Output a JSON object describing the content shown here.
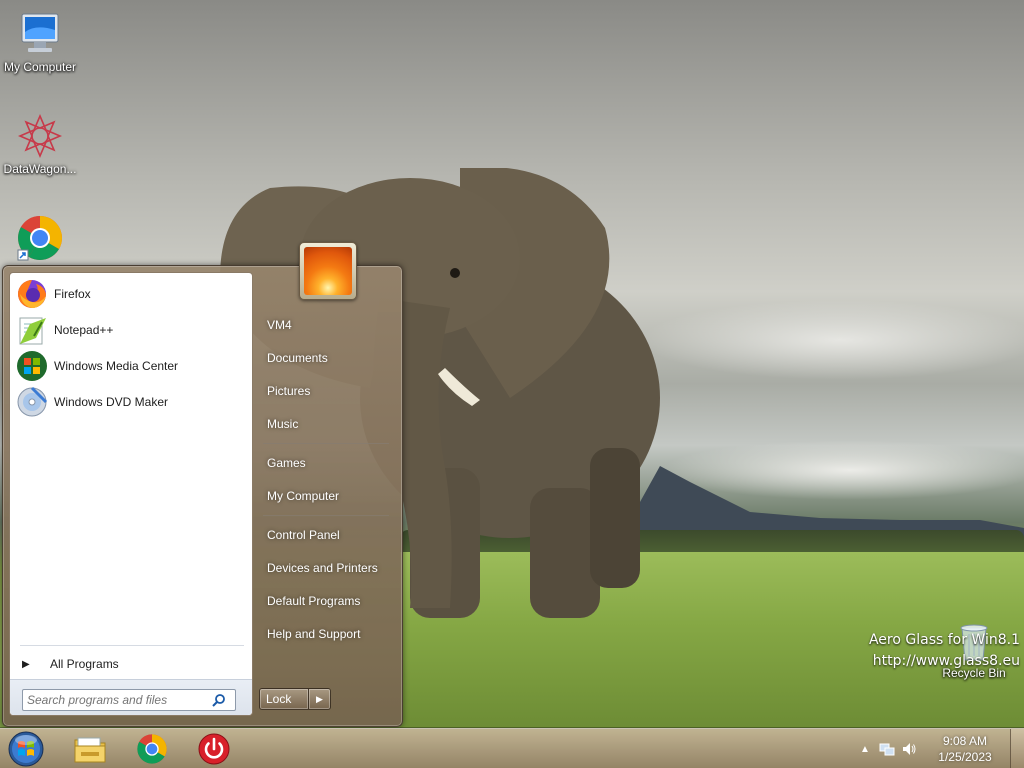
{
  "desktop": {
    "icons": [
      {
        "label": "My Computer",
        "icon": "computer-icon"
      },
      {
        "label": "DataWagon...",
        "icon": "datawagon-icon"
      },
      {
        "label": "",
        "icon": "chrome-shortcut-icon"
      },
      {
        "label": "Recycle Bin",
        "icon": "recycle-bin-icon"
      }
    ],
    "watermark": {
      "line1": "Aero Glass for Win8.1",
      "line2": "http://www.glass8.eu"
    }
  },
  "start_menu": {
    "programs": [
      {
        "label": "Firefox",
        "icon": "firefox-icon"
      },
      {
        "label": "Notepad++",
        "icon": "notepadpp-icon"
      },
      {
        "label": "Windows Media Center",
        "icon": "media-center-icon"
      },
      {
        "label": "Windows DVD Maker",
        "icon": "dvd-maker-icon"
      }
    ],
    "all_programs": "All Programs",
    "search": {
      "placeholder": "Search programs and files",
      "value": ""
    },
    "right": {
      "user": "VM4",
      "documents": "Documents",
      "pictures": "Pictures",
      "music": "Music",
      "games": "Games",
      "my_computer": "My Computer",
      "control_panel": "Control Panel",
      "devices": "Devices and Printers",
      "default_programs": "Default Programs",
      "help": "Help and Support"
    },
    "lock_label": "Lock"
  },
  "taskbar": {
    "pinned": [
      "file-explorer-icon",
      "chrome-icon",
      "power-icon"
    ],
    "clock": {
      "time": "9:08 AM",
      "date": "1/25/2023"
    },
    "tray_icons": [
      "show-hidden-icons-icon",
      "network-icon",
      "volume-icon"
    ]
  },
  "colors": {
    "accent": "#8f7a5c",
    "start_left_bg": "#ffffff",
    "text_light": "#ffffff"
  }
}
